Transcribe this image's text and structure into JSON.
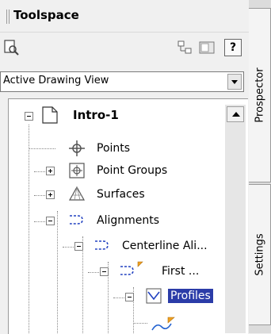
{
  "window": {
    "title": "Toolspace"
  },
  "toolbar": {
    "icons": [
      "magnify-page-icon",
      "tree-toggle-icon",
      "panel-icon"
    ],
    "help_label": "?"
  },
  "view_selector": {
    "selected": "Active Drawing View"
  },
  "tree": {
    "root": "Intro-1",
    "points": "Points",
    "point_groups": "Point Groups",
    "surfaces": "Surfaces",
    "alignments": "Alignments",
    "centerline": "Centerline Ali...",
    "first": "First ...",
    "profiles": "Profiles"
  },
  "side_tabs": {
    "prospector": "Prospector",
    "settings": "Settings"
  },
  "colors": {
    "selection": "#2b3ca8",
    "alignment_icon": "#2040c0",
    "flag": "#f0a020"
  }
}
